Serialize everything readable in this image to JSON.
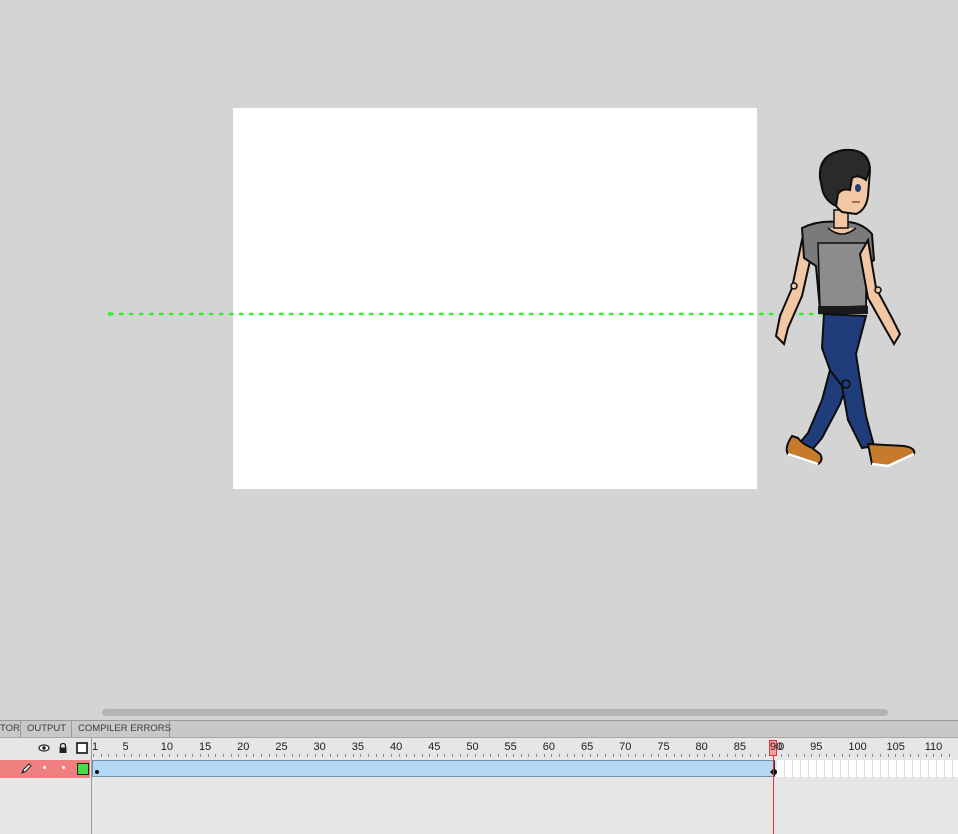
{
  "colors": {
    "pasteboard": "#d4d4d4",
    "stage": "#ffffff",
    "motion_path": "#33ee33",
    "layer_selected": "#f08080",
    "tween_span": "#b3d8f5",
    "playhead": "#dd3333",
    "keyframe_indicator": "#44dd44"
  },
  "panel_tabs": [
    {
      "label": "TOR"
    },
    {
      "label": "OUTPUT"
    },
    {
      "label": "COMPILER ERRORS"
    }
  ],
  "timeline": {
    "header_icons": [
      "eye-icon",
      "lock-icon",
      "outline-icon"
    ],
    "frame_labels": [
      "1",
      "5",
      "10",
      "15",
      "20",
      "25",
      "30",
      "35",
      "40",
      "45",
      "50",
      "55",
      "60",
      "65",
      "70",
      "75",
      "80",
      "85",
      "90",
      "95",
      "100",
      "105",
      "110"
    ],
    "current_frame": "90",
    "layer": {
      "icons": [
        "pencil-icon",
        "visibility-dot-icon",
        "lock-dot-icon",
        "outline-color-icon"
      ],
      "tween_start_frame": 1,
      "tween_end_frame": 90
    }
  }
}
